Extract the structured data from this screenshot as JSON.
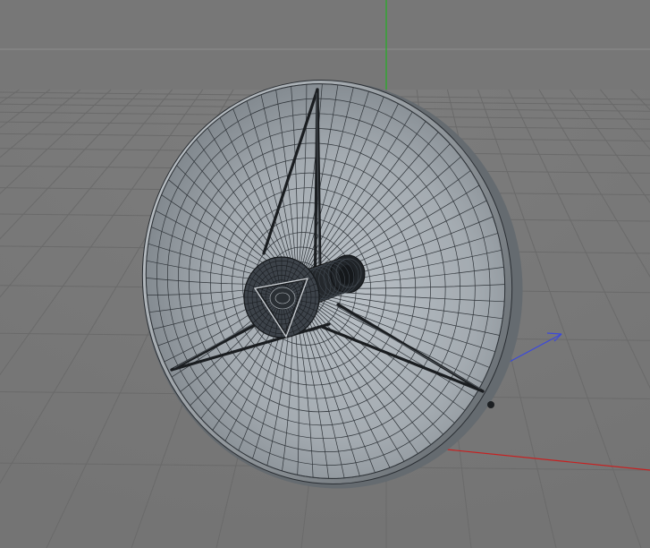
{
  "viewport": {
    "background_color": "#7a7a7a",
    "grid_color": "#6a6a6a",
    "horizon_color": "#9a9a9a",
    "axis_colors": {
      "x": "#c02020",
      "y": "#20a020",
      "z": "#3a48d8"
    }
  },
  "model": {
    "dish_face_color": "#a9b0b6",
    "dish_shade_color": "#7f868c",
    "wire_color": "#2a2e33",
    "strut_color": "#1c1f22",
    "feed_color": "#2b2f33",
    "feed_dark_color": "#14171a"
  }
}
